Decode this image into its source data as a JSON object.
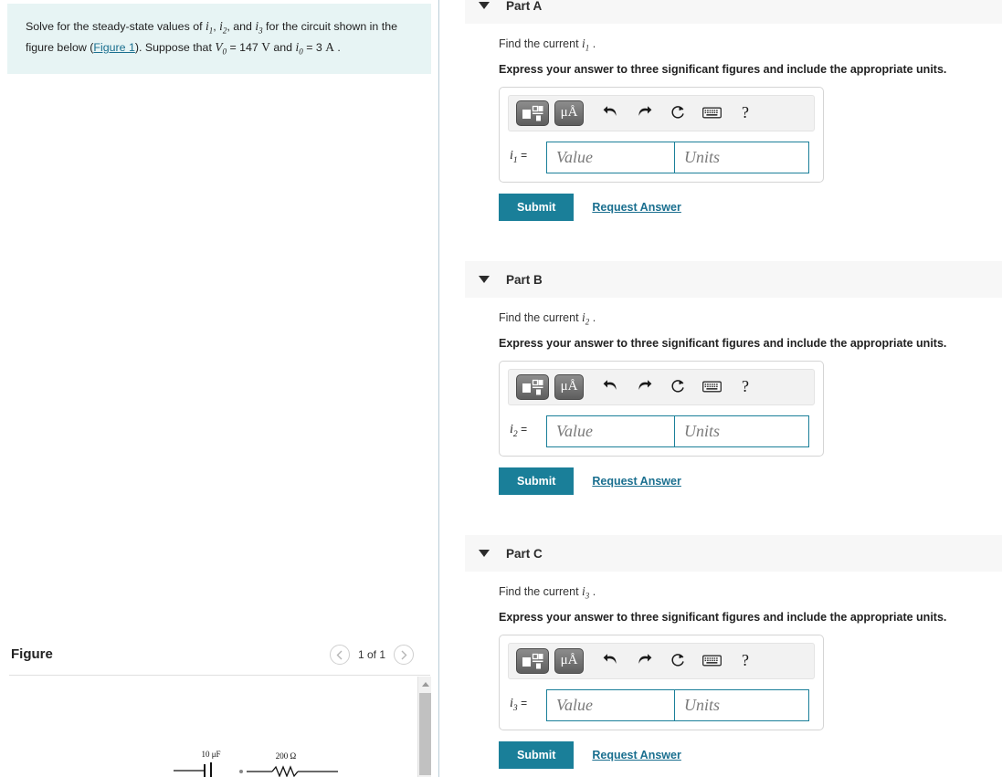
{
  "problem": {
    "text_before_vars": "Solve for the steady-state values of ",
    "var1": "i",
    "var1_sub": "1",
    "sep1": ", ",
    "var2": "i",
    "var2_sub": "2",
    "sep2": ", and ",
    "var3": "i",
    "var3_sub": "3",
    "text_mid": " for the circuit shown in the figure below (",
    "figure_link": "Figure 1",
    "text_after_link": "). Suppose that ",
    "v_symbol": "V",
    "v_sub": "0",
    "v_eq": " = 147 ",
    "v_unit": "V",
    "and_text": " and ",
    "i0_symbol": "i",
    "i0_sub": "0",
    "i0_eq": " = 3 ",
    "i0_unit": "A",
    "trailing": " ."
  },
  "figure": {
    "title": "Figure",
    "prev_label": "‹",
    "next_label": "›",
    "count": "1 of 1",
    "circuit": {
      "cap_label": "10 μF",
      "res_label": "200 Ω"
    }
  },
  "toolbar": {
    "template_icon": "math-template-icon",
    "units_label": "μÅ",
    "undo_icon": "undo-arrow-icon",
    "redo_icon": "redo-arrow-icon",
    "reset_icon": "reset-circle-icon",
    "keyboard_icon": "keyboard-icon",
    "help_label": "?"
  },
  "colors": {
    "accent_teal": "#1a7f99",
    "link_teal": "#1a6f8f",
    "problem_bg": "#e7f4f4",
    "part_header_bg": "#f7f7f7",
    "field_border": "#1a7f99"
  },
  "parts": [
    {
      "id": "a",
      "label": "Part A",
      "caret": "caret-down-icon",
      "question_prefix": "Find the current ",
      "question_var": "i",
      "question_sub": "1",
      "question_suffix": " .",
      "instruction": "Express your answer to three significant figures and include the appropriate units.",
      "eq_var": "i",
      "eq_sub": "1",
      "eq_sign": "=",
      "value_placeholder": "Value",
      "units_placeholder": "Units",
      "value": "",
      "units": "",
      "submit_label": "Submit",
      "request_label": "Request Answer"
    },
    {
      "id": "b",
      "label": "Part B",
      "caret": "caret-down-icon",
      "question_prefix": "Find the current ",
      "question_var": "i",
      "question_sub": "2",
      "question_suffix": " .",
      "instruction": "Express your answer to three significant figures and include the appropriate units.",
      "eq_var": "i",
      "eq_sub": "2",
      "eq_sign": "=",
      "value_placeholder": "Value",
      "units_placeholder": "Units",
      "value": "",
      "units": "",
      "submit_label": "Submit",
      "request_label": "Request Answer"
    },
    {
      "id": "c",
      "label": "Part C",
      "caret": "caret-down-icon",
      "question_prefix": "Find the current ",
      "question_var": "i",
      "question_sub": "3",
      "question_suffix": " .",
      "instruction": "Express your answer to three significant figures and include the appropriate units.",
      "eq_var": "i",
      "eq_sub": "3",
      "eq_sign": "=",
      "value_placeholder": "Value",
      "units_placeholder": "Units",
      "value": "",
      "units": "",
      "submit_label": "Submit",
      "request_label": "Request Answer"
    }
  ]
}
